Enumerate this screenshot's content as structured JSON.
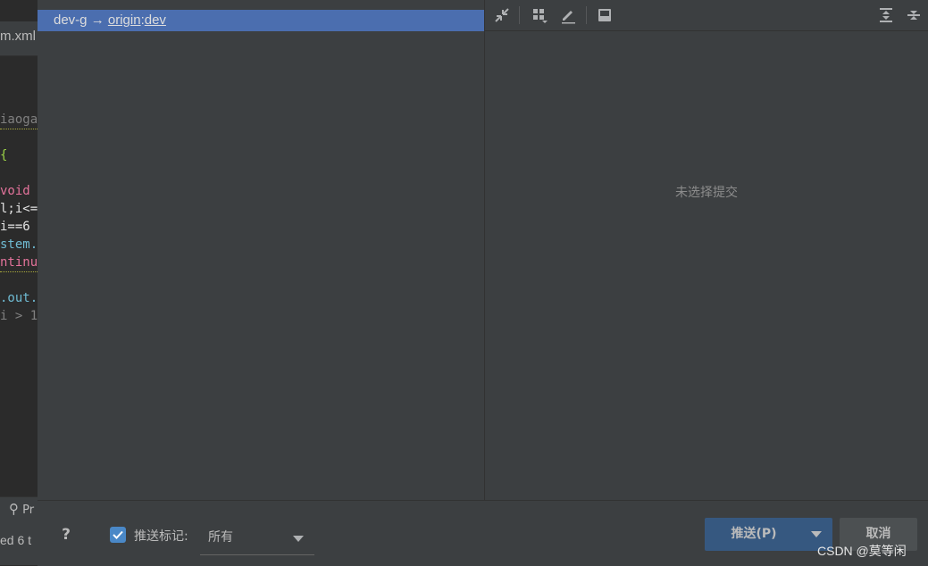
{
  "background_editor": {
    "tab_label": "m.xml",
    "code_lines": [
      {
        "text": "iaoga",
        "color": "#808080",
        "squiggle": true
      },
      {
        "text": "{",
        "color": "#9bd247",
        "squiggle": false
      },
      {
        "text": "void",
        "color": "#e3739b",
        "squiggle": false
      },
      {
        "text": "l;i<=",
        "color": "#e2e2e2",
        "squiggle": false
      },
      {
        "text": "i==6",
        "color": "#e2e2e2",
        "squiggle": false
      },
      {
        "text": "stem.",
        "color": "#6fbbd3",
        "squiggle": false
      },
      {
        "text": "ntinu",
        "color": "#e3739b",
        "squiggle": true
      },
      {
        "text": ".out.",
        "color": "#6fbbd3",
        "squiggle": false
      },
      {
        "text": "i > 1",
        "color": "#808080",
        "squiggle": false
      }
    ],
    "status_tab": "Pr",
    "status_text": "ed 6 t"
  },
  "commit_tree": {
    "row": {
      "local_branch": "dev-g",
      "arrow": "→",
      "remote": "origin",
      "separator": ":",
      "remote_branch": "dev"
    }
  },
  "details_panel": {
    "toolbar_icons": [
      "collapse-icon",
      "group-by-icon",
      "edit-icon",
      "save-icon",
      "expand-all-icon",
      "collapse-all-icon"
    ],
    "empty_text": "未选择提交"
  },
  "footer": {
    "help_label": "?",
    "push_tags_label": "推送标记:",
    "push_tags_checked": true,
    "tags_select_value": "所有",
    "push_button_label": "推送(P)",
    "cancel_button_label": "取消",
    "watermark": "CSDN @莫等闲"
  },
  "colors": {
    "selection": "#4b6eaf",
    "primary_button": "#365880",
    "checkbox": "#4a88c7"
  }
}
